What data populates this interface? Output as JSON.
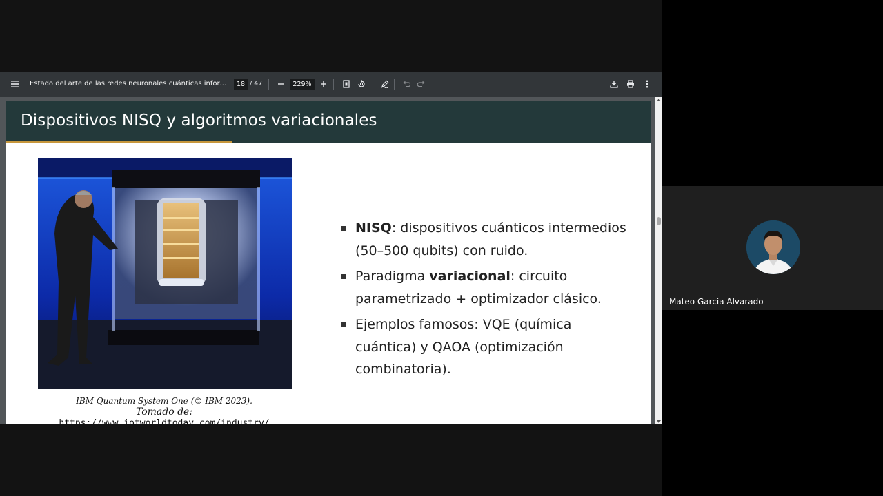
{
  "toolbar": {
    "document_title": "Estado del arte de las redes neuronales cuánticas informadas...",
    "current_page": "18",
    "page_total": "/ 47",
    "zoom": "229%",
    "icons": {
      "menu": "menu-icon",
      "zoom_out": "minus-icon",
      "zoom_in": "plus-icon",
      "fit": "fit-page-icon",
      "rotate": "rotate-icon",
      "annotate": "pen-icon",
      "undo": "undo-icon",
      "redo": "redo-icon",
      "download": "download-icon",
      "print": "print-icon",
      "more": "more-vertical-icon"
    }
  },
  "slide": {
    "title": "Dispositivos NISQ y algoritmos variacionales",
    "caption_line1": "IBM Quantum System One (© IBM 2023).",
    "caption_line2": "Tomado de:",
    "caption_line3": "https://www.iotworldtoday.com/industry/",
    "bullets": [
      {
        "bold": "NISQ",
        "rest": ": dispositivos cuánticos intermedios (50–500 qubits) con ruido."
      },
      {
        "pre": "Paradigma ",
        "bold": "variacional",
        "rest": ": circuito parametrizado + optimizador clásico."
      },
      {
        "text": "Ejemplos famosos: VQE (química cuántica) y QAOA (optimización combinatoria)."
      }
    ]
  },
  "participant": {
    "name": "Mateo Garcia Alvarado"
  },
  "colors": {
    "toolbar_bg": "#323639",
    "slide_header_bg": "#23393a",
    "slide_accent": "#c7973c",
    "viewer_bg": "#525659"
  }
}
